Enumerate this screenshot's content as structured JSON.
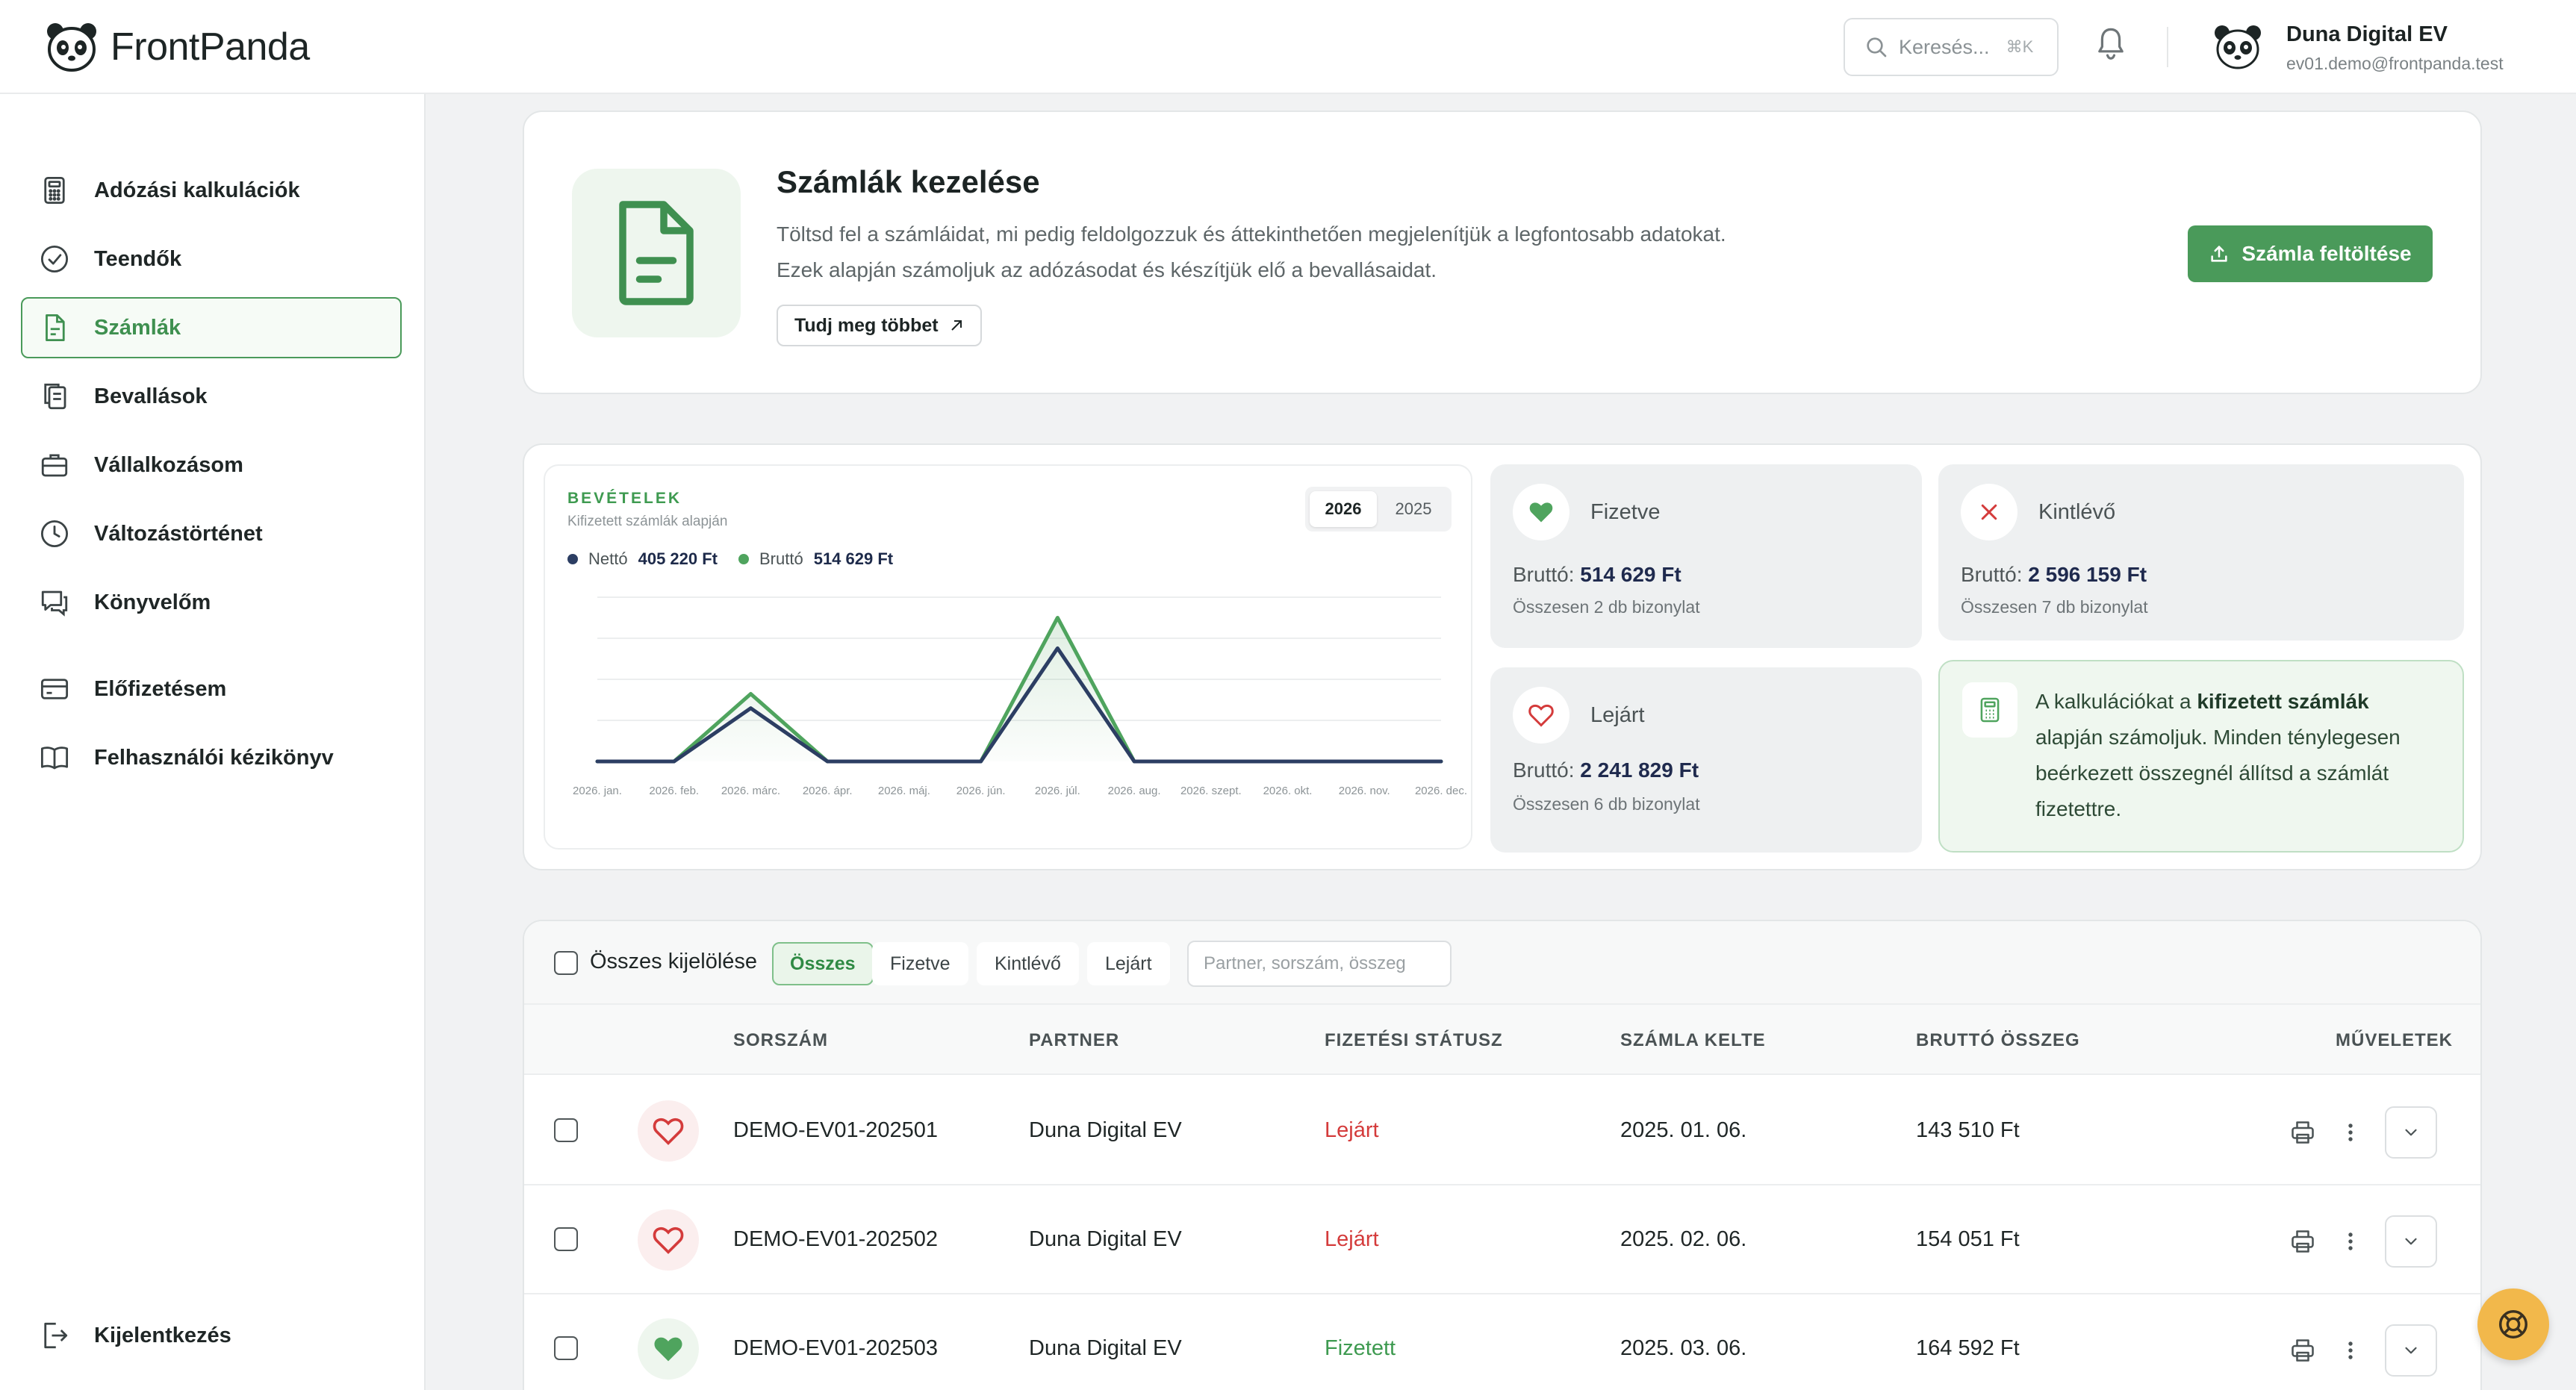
{
  "app": {
    "name": "FrontPanda"
  },
  "header": {
    "search_placeholder": "Keresés...",
    "search_shortcut": "⌘K",
    "user_name": "Duna Digital EV",
    "user_email": "ev01.demo@frontpanda.test"
  },
  "sidebar": {
    "items": [
      {
        "label": "Adózási kalkulációk",
        "icon": "calculator-icon"
      },
      {
        "label": "Teendők",
        "icon": "check-circle-icon"
      },
      {
        "label": "Számlák",
        "icon": "invoice-icon",
        "active": true
      },
      {
        "label": "Bevallások",
        "icon": "documents-icon"
      },
      {
        "label": "Vállalkozásom",
        "icon": "briefcase-icon"
      },
      {
        "label": "Változástörténet",
        "icon": "clock-icon"
      },
      {
        "label": "Könyvelőm",
        "icon": "chat-icon"
      },
      {
        "label": "Előfizetésem",
        "icon": "credit-card-icon"
      },
      {
        "label": "Felhasználói kézikönyv",
        "icon": "book-icon"
      }
    ],
    "logout_label": "Kijelentkezés"
  },
  "hero": {
    "title": "Számlák kezelése",
    "desc_line1": "Töltsd fel a számláidat, mi pedig feldolgozzuk és áttekinthetően megjelenítjük a legfontosabb adatokat.",
    "desc_line2": "Ezek alapján számoljuk az adózásodat és készítjük elő a bevallásaidat.",
    "learn_more": "Tudj meg többet",
    "upload_button": "Számla feltöltése"
  },
  "chart_card": {
    "title": "BEVÉTELEK",
    "subtitle": "Kifizetett számlák alapján",
    "years": [
      "2026",
      "2025"
    ],
    "active_year": "2026",
    "net_label": "Nettó",
    "net_value": "405 220 Ft",
    "gross_label": "Bruttó",
    "gross_value": "514 629 Ft"
  },
  "chart_data": {
    "type": "line",
    "categories": [
      "2026. jan.",
      "2026. feb.",
      "2026. márc.",
      "2026. ápr.",
      "2026. máj.",
      "2026. jún.",
      "2026. júl.",
      "2026. aug.",
      "2026. szept.",
      "2026. okt.",
      "2026. nov.",
      "2026. dec."
    ],
    "series": [
      {
        "name": "Nettó",
        "color": "#2c3e63",
        "values": [
          0,
          0,
          129600,
          0,
          0,
          0,
          275620,
          0,
          0,
          0,
          0,
          0
        ]
      },
      {
        "name": "Bruttó",
        "color": "#4fa45e",
        "values": [
          0,
          0,
          164592,
          0,
          0,
          0,
          350037,
          0,
          0,
          0,
          0,
          0
        ]
      }
    ],
    "ylim": [
      0,
      400000
    ],
    "grid": true,
    "legend": "top-left"
  },
  "stats": {
    "paid": {
      "label": "Fizetve",
      "gross_prefix": "Bruttó:",
      "gross": "514 629 Ft",
      "count": "Összesen 2 db bizonylat"
    },
    "outstanding": {
      "label": "Kintlévő",
      "gross_prefix": "Bruttó:",
      "gross": "2 596 159 Ft",
      "count": "Összesen 7 db bizonylat"
    },
    "overdue": {
      "label": "Lejárt",
      "gross_prefix": "Bruttó:",
      "gross": "2 241 829 Ft",
      "count": "Összesen 6 db bizonylat"
    },
    "info_pre": "A kalkulációkat a ",
    "info_bold": "kifizetett számlák",
    "info_post": " alapján számoljuk. Minden ténylegesen beérkezett összegnél állítsd a számlát fizetettre."
  },
  "table": {
    "select_all": "Összes kijelölése",
    "filters": [
      "Összes",
      "Fizetve",
      "Kintlévő",
      "Lejárt"
    ],
    "active_filter": "Összes",
    "filter_placeholder": "Partner, sorszám, összeg",
    "columns": [
      "SORSZÁM",
      "PARTNER",
      "FIZETÉSI STÁTUSZ",
      "SZÁMLA KELTE",
      "BRUTTÓ ÖSSZEG",
      "MŰVELETEK"
    ],
    "rows": [
      {
        "number": "DEMO-EV01-202501",
        "partner": "Duna Digital EV",
        "status": "Lejárt",
        "status_type": "late",
        "date": "2025. 01. 06.",
        "gross": "143 510 Ft"
      },
      {
        "number": "DEMO-EV01-202502",
        "partner": "Duna Digital EV",
        "status": "Lejárt",
        "status_type": "late",
        "date": "2025. 02. 06.",
        "gross": "154 051 Ft"
      },
      {
        "number": "DEMO-EV01-202503",
        "partner": "Duna Digital EV",
        "status": "Fizetett",
        "status_type": "paid",
        "date": "2025. 03. 06.",
        "gross": "164 592 Ft"
      }
    ]
  },
  "colors": {
    "accent": "#4a9a5a",
    "danger": "#d43b3b",
    "fab": "#f2b84b"
  }
}
